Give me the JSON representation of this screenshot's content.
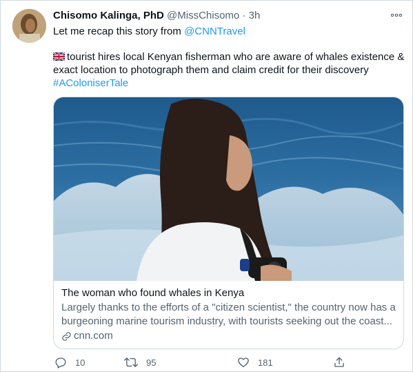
{
  "tweet": {
    "author_name": "Chisomo Kalinga, PhD",
    "handle": "@MissChisomo",
    "separator": "·",
    "time": "3h",
    "text_line1_prefix": "Let me recap this story from ",
    "text_line1_mention": "@CNNTravel",
    "text_para2": "tourist hires local Kenyan fisherman who are aware of whales existence & exact location to photograph them and claim credit for their discovery",
    "hashtag": "#AColoniserTale",
    "flag_icon": "uk-flag-icon"
  },
  "card": {
    "title": "The woman who found whales in Kenya",
    "description_line1": "Largely thanks to the efforts of a \"citizen scientist,\" the country now has a",
    "description_line2": "burgeoning marine tourism industry, with tourists seeking out the coast...",
    "domain": "cnn.com",
    "image_icon": "woman-with-camera-by-sea-photo"
  },
  "actions": {
    "reply_count": "10",
    "retweet_count": "95",
    "like_count": "181"
  },
  "colors": {
    "link": "#1d9bf0",
    "secondary_text": "#536471",
    "border": "#cfd9de"
  }
}
